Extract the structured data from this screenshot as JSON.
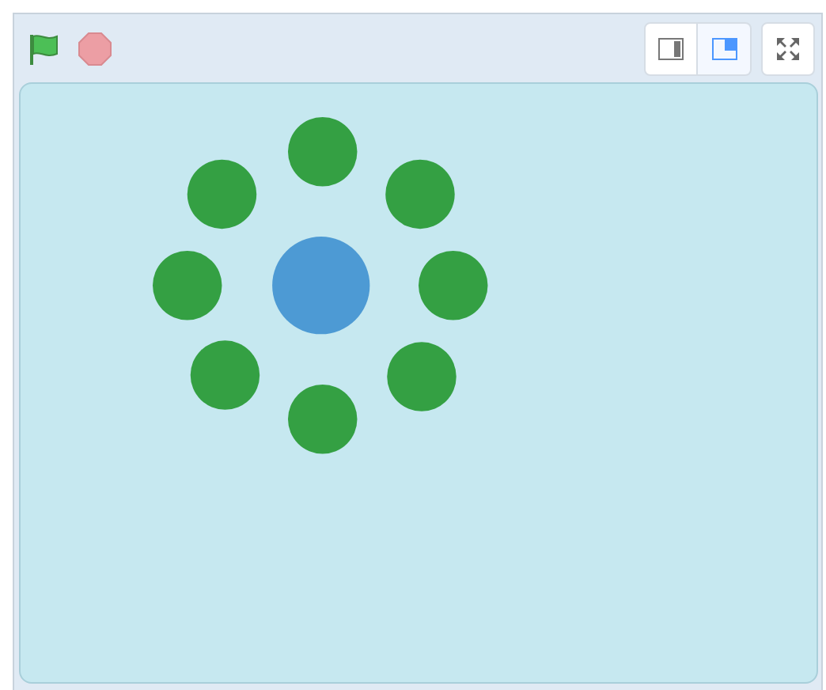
{
  "stage_modes": [
    {
      "kind": "small",
      "selected": false
    },
    {
      "kind": "large",
      "selected": true
    }
  ]
}
